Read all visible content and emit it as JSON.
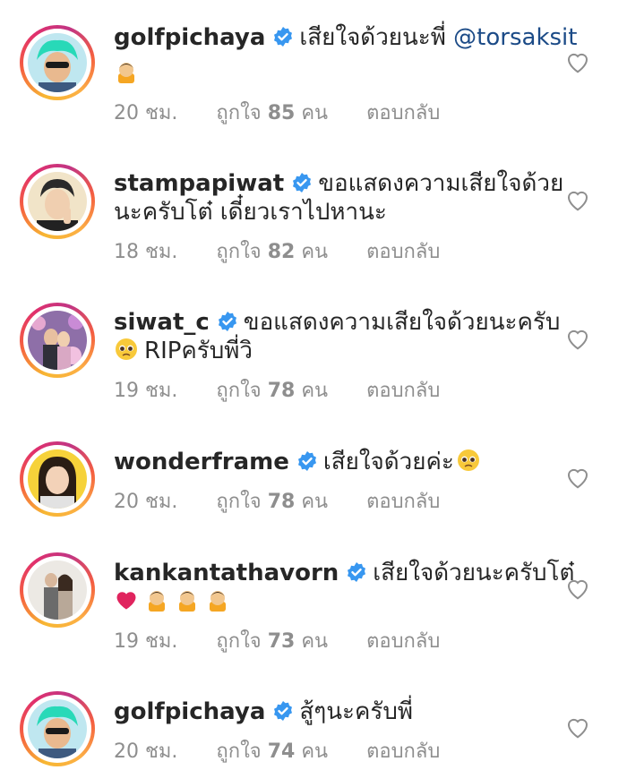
{
  "comments": [
    {
      "username": "golfpichaya",
      "text": "เสียใจด้วยนะพี่",
      "mention": "@torsaksit",
      "emoji": [
        "sad-praying-face-emoji"
      ],
      "time": "20 ชม.",
      "likes_prefix": "ถูกใจ",
      "likes_count": "85",
      "likes_suffix": "คน",
      "reply": "ตอบกลับ"
    },
    {
      "username": "stampapiwat",
      "text": "ขอแสดงความเสียใจด้วย",
      "text2": "นะครับโต๋ เดี๋ยวเราไปหานะ",
      "time": "18 ชม.",
      "likes_prefix": "ถูกใจ",
      "likes_count": "82",
      "likes_suffix": "คน",
      "reply": "ตอบกลับ"
    },
    {
      "username": "siwat_c",
      "text": "ขอแสดงความเสียใจด้วยนะครับ",
      "text2": "RIPครับพี่วิ",
      "emoji": [
        "pleading-face-emoji"
      ],
      "time": "19 ชม.",
      "likes_prefix": "ถูกใจ",
      "likes_count": "78",
      "likes_suffix": "คน",
      "reply": "ตอบกลับ"
    },
    {
      "username": "wonderframe",
      "text": "เสียใจด้วยค่ะ",
      "emoji": [
        "pleading-face-emoji"
      ],
      "time": "20 ชม.",
      "likes_prefix": "ถูกใจ",
      "likes_count": "78",
      "likes_suffix": "คน",
      "reply": "ตอบกลับ"
    },
    {
      "username": "kankantathavorn",
      "text": "เสียใจด้วยนะครับโต๋",
      "emoji": [
        "red-heart-emoji",
        "sad-praying-face-emoji",
        "sad-praying-face-emoji",
        "sad-praying-face-emoji"
      ],
      "time": "19 ชม.",
      "likes_prefix": "ถูกใจ",
      "likes_count": "73",
      "likes_suffix": "คน",
      "reply": "ตอบกลับ"
    },
    {
      "username": "golfpichaya",
      "text": "สู้ๆนะครับพี่",
      "time": "20 ชม.",
      "likes_prefix": "ถูกใจ",
      "likes_count": "74",
      "likes_suffix": "คน",
      "reply": "ตอบกลับ"
    }
  ],
  "colors": {
    "username": "#262626",
    "meta": "#8e8e8e",
    "mention": "#1c4b87",
    "verified": "#3897f0"
  }
}
